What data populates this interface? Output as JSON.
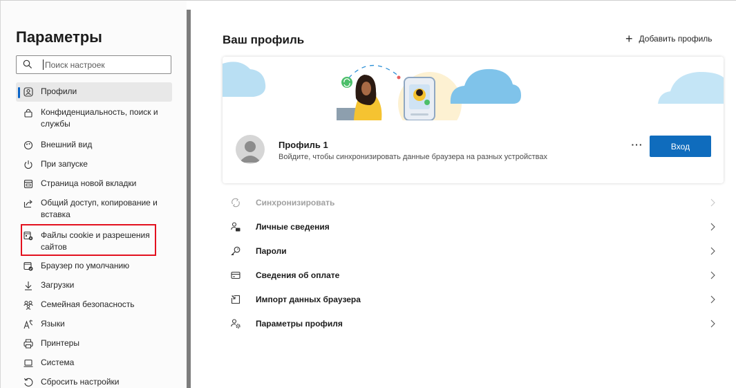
{
  "sidebar": {
    "title": "Параметры",
    "search": {
      "placeholder": "Поиск настроек"
    },
    "items": [
      {
        "label": "Профили",
        "icon": "profile-icon",
        "active": true
      },
      {
        "label": "Конфиденциальность, поиск и службы",
        "icon": "lock-icon"
      },
      {
        "label": "Внешний вид",
        "icon": "appearance-icon"
      },
      {
        "label": "При запуске",
        "icon": "power-icon"
      },
      {
        "label": "Страница новой вкладки",
        "icon": "new-tab-icon"
      },
      {
        "label": "Общий доступ, копирование и вставка",
        "icon": "share-icon"
      },
      {
        "label": "Файлы cookie и разрешения сайтов",
        "icon": "cookie-permissions-icon",
        "highlighted": true
      },
      {
        "label": "Браузер по умолчанию",
        "icon": "default-browser-icon"
      },
      {
        "label": "Загрузки",
        "icon": "download-icon"
      },
      {
        "label": "Семейная безопасность",
        "icon": "family-icon"
      },
      {
        "label": "Языки",
        "icon": "language-icon"
      },
      {
        "label": "Принтеры",
        "icon": "printer-icon"
      },
      {
        "label": "Система",
        "icon": "system-icon"
      },
      {
        "label": "Сбросить настройки",
        "icon": "reset-icon"
      }
    ]
  },
  "main": {
    "title": "Ваш профиль",
    "add_profile_label": "Добавить профиль",
    "profile": {
      "name": "Профиль 1",
      "description": "Войдите, чтобы синхронизировать данные браузера на разных устройствах",
      "more_label": "···",
      "signin_label": "Вход"
    },
    "settings": [
      {
        "label": "Синхронизировать",
        "icon": "sync-icon",
        "disabled": true
      },
      {
        "label": "Личные сведения",
        "icon": "personal-info-icon"
      },
      {
        "label": "Пароли",
        "icon": "key-icon"
      },
      {
        "label": "Сведения об оплате",
        "icon": "credit-card-icon"
      },
      {
        "label": "Импорт данных браузера",
        "icon": "import-icon"
      },
      {
        "label": "Параметры профиля",
        "icon": "profile-settings-icon"
      }
    ]
  },
  "colors": {
    "accent": "#0f6cbd",
    "highlight_border": "#e3101e",
    "active_indicator": "#0a64c8"
  }
}
